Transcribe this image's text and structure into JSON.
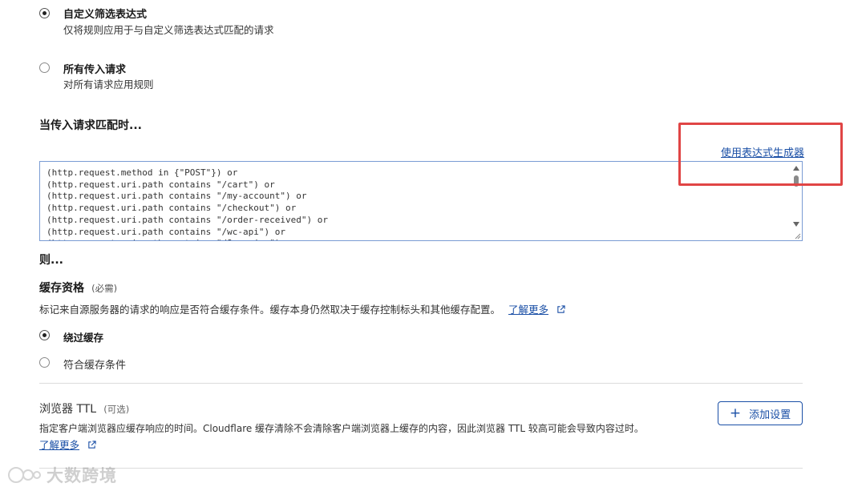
{
  "filter_options": {
    "custom": {
      "title": "自定义筛选表达式",
      "description": "仅将规则应用于与自定义筛选表达式匹配的请求",
      "selected": true
    },
    "all": {
      "title": "所有传入请求",
      "description": "对所有请求应用规则",
      "selected": false
    }
  },
  "match_heading": "当传入请求匹配时...",
  "expression_builder_link": "使用表达式生成器",
  "expression": "(http.request.method in {\"POST\"}) or\n(http.request.uri.path contains \"/cart\") or\n(http.request.uri.path contains \"/my-account\") or\n(http.request.uri.path contains \"/checkout\") or\n(http.request.uri.path contains \"/order-received\") or\n(http.request.uri.path contains \"/wc-api\") or\n(http.request.uri.path contains \"/?wc-ajax\")",
  "then_heading": "则...",
  "cache_eligibility": {
    "title": "缓存资格",
    "required_tag": "(必需)",
    "description": "标记来自源服务器的请求的响应是否符合缓存条件。缓存本身仍然取决于缓存控制标头和其他缓存配置。",
    "learn_more": "了解更多",
    "options": [
      {
        "label": "绕过缓存",
        "selected": true
      },
      {
        "label": "符合缓存条件",
        "selected": false
      }
    ]
  },
  "browser_ttl": {
    "title": "浏览器 TTL",
    "optional_tag": "(可选)",
    "description": "指定客户端浏览器应缓存响应的时间。Cloudflare 缓存清除不会清除客户端浏览器上缓存的内容，因此浏览器 TTL 较高可能会导致内容过时。",
    "learn_more": "了解更多",
    "add_button": "添加设置",
    "add_icon": "+"
  },
  "watermark": "大数跨境",
  "colors": {
    "link": "#1a4fa6",
    "highlight_box": "#e04545",
    "editor_border": "#7a9cd4"
  }
}
